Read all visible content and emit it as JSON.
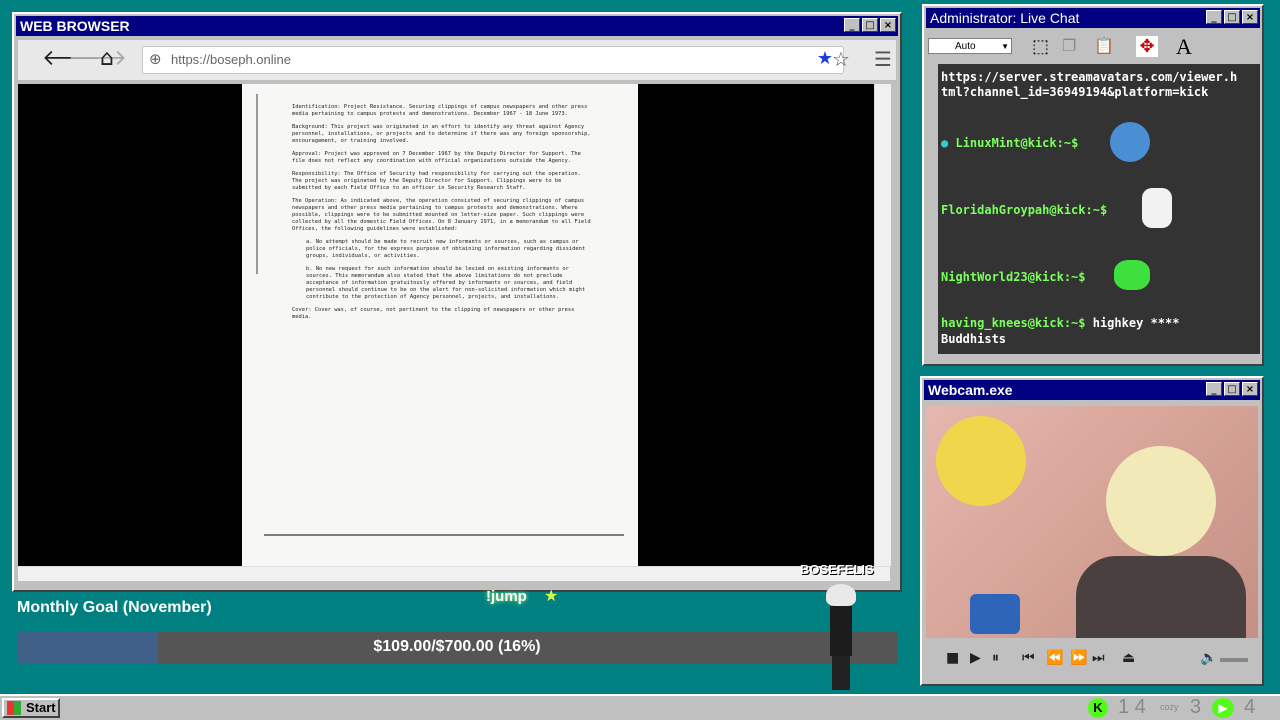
{
  "browser": {
    "title": "WEB BROWSER",
    "url": "https://boseph.online",
    "document_lines": [
      "Identification: Project Resistance. Securing clippings of campus newspapers and other press media pertaining to campus protests and demonstrations. December 1967 - 18 June 1973.",
      "Background: This project was originated in an effort to identify any threat against Agency personnel, installations, or projects and to determine if there was any foreign sponsorship, encouragement, or training involved.",
      "Approval: Project was approved on 7 December 1967 by the Deputy Director for Support. The file does not reflect any coordination with official organizations outside the Agency.",
      "Responsibility: The Office of Security had responsibility for carrying out the operation. The project was originated by the Deputy Director for Support. Clippings were to be submitted by each Field Office to an officer in Security Research Staff.",
      "The Operation: As indicated above, the operation consisted of securing clippings of campus newspapers and other press media pertaining to campus protests and demonstrations. Where possible, clippings were to be submitted mounted on letter-size paper. Such clippings were collected by all the domestic Field Offices. On 8 January 1971, in a memorandum to all Field Offices, the following guidelines were established:",
      "a. No attempt should be made to recruit new informants or sources, such as campus or police officials, for the express purpose of obtaining information regarding dissident groups, individuals, or activities.",
      "b. No new request for such information should be levied on existing informants or sources. This memorandum also stated that the above limitations do not preclude acceptance of information gratuitously offered by informants or sources, and field personnel should continue to be on the alert for non-solicited information which might contribute to the protection of Agency personnel, projects, and installations.",
      "Cover: Cover was, of course, not pertinent to the clipping of newspapers or other press media."
    ]
  },
  "chat": {
    "title": "Administrator: Live Chat",
    "font_select": "Auto",
    "messages": [
      {
        "user": "",
        "text": "https://server.streamavatars.com/viewer.h"
      },
      {
        "user": "",
        "text": "tml?channel_id=36949194&platform=kick"
      },
      {
        "user": "LinuxMint@kick:~$",
        "text": ""
      },
      {
        "user": "FloridahGroypah@kick:~$",
        "text": ""
      },
      {
        "user": "NightWorld23@kick:~$",
        "text": ""
      },
      {
        "user": "having_knees@kick:~$",
        "text": "highkey ****"
      },
      {
        "user": "",
        "text": "Buddhists"
      }
    ]
  },
  "webcam": {
    "title": "Webcam.exe"
  },
  "stream": {
    "username": "BOSEFELIS",
    "jump_label": "!jump",
    "goal_title": "Monthly Goal (November)",
    "goal_text": "$109.00/$700.00 (16%)",
    "goal_fraction": 0.16
  },
  "taskbar": {
    "start_label": "Start",
    "kick_count": "1 4",
    "mid_count": "3",
    "end_count": "4",
    "cozy_label": "cozy"
  },
  "colors": {
    "desktop": "#008080",
    "titlebar": "#000080",
    "accent_green": "#53fc18"
  }
}
